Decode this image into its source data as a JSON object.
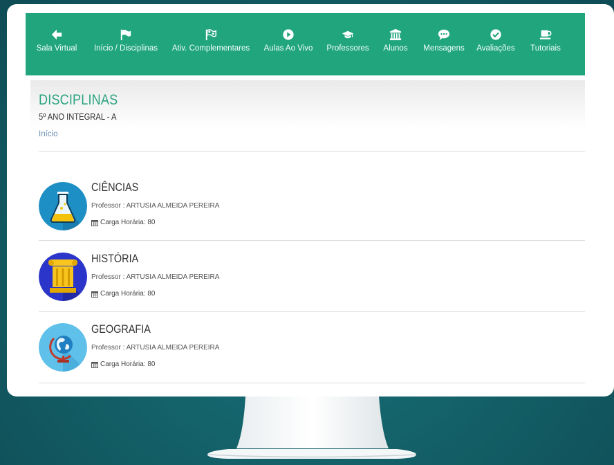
{
  "nav": {
    "items": [
      {
        "label": "Sala Virtual",
        "icon": "arrow-left-icon"
      },
      {
        "label": "Início / Disciplinas",
        "icon": "flag-icon"
      },
      {
        "label": "Ativ. Complementares",
        "icon": "checkered-flag-icon"
      },
      {
        "label": "Aulas Ao Vivo",
        "icon": "play-icon"
      },
      {
        "label": "Professores",
        "icon": "graduation-cap-icon"
      },
      {
        "label": "Alunos",
        "icon": "university-icon"
      },
      {
        "label": "Mensagens",
        "icon": "comment-icon"
      },
      {
        "label": "Avaliações",
        "icon": "check-circle-icon"
      },
      {
        "label": "Tutoriais",
        "icon": "coffee-icon"
      }
    ]
  },
  "header": {
    "title": "DISCIPLINAS",
    "subtitle": "5º ANO INTEGRAL - A",
    "breadcrumb": "Início"
  },
  "courses": [
    {
      "name": "CIÊNCIAS",
      "professor": "Professor : ARTUSIA ALMEIDA PEREIRA",
      "hours": "Carga Horária: 80",
      "icon": "flask-icon"
    },
    {
      "name": "HISTÓRIA",
      "professor": "Professor : ARTUSIA ALMEIDA PEREIRA",
      "hours": "Carga Horária: 80",
      "icon": "column-icon"
    },
    {
      "name": "GEOGRAFIA",
      "professor": "Professor : ARTUSIA ALMEIDA PEREIRA",
      "hours": "Carga Horária: 80",
      "icon": "globe-icon"
    }
  ],
  "colors": {
    "accent": "#21a57d",
    "title": "#2aa481",
    "link": "#6a8fb3",
    "background": "#135e66"
  }
}
